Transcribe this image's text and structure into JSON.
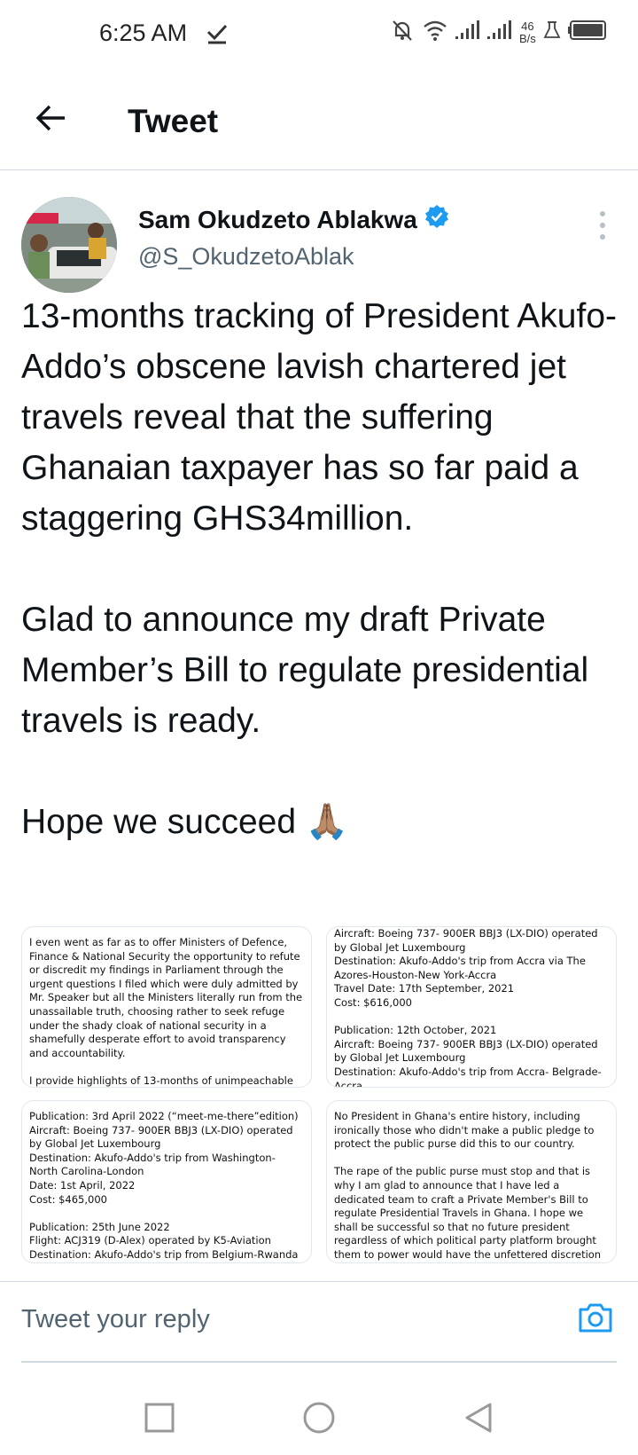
{
  "status_bar": {
    "time": "6:25 AM",
    "net_speed_value": "46",
    "net_speed_unit": "B/s",
    "icons": [
      "check-icon",
      "mute-icon",
      "wifi-icon",
      "signal-icon",
      "signal-icon",
      "lab-icon",
      "battery-icon"
    ]
  },
  "header": {
    "title": "Tweet",
    "back_icon": "arrow-left-icon"
  },
  "author": {
    "name": "Sam Okudzeto Ablakwa",
    "handle": "@S_OkudzetoAblak",
    "verified": true,
    "verified_color": "#1d9bf0"
  },
  "tweet": {
    "text": "13-months tracking of President Akufo-Addo’s obscene lavish chartered jet travels reveal that the suffering Ghanaian taxpayer has so far paid a staggering GHS34million.\n\nGlad to announce my draft Private Member’s Bill to regulate presidential travels is ready.\n\nHope we succeed 🙏🏽"
  },
  "media": [
    {
      "text": "I even went as far as to offer Ministers of Defence, Finance & National Security the opportunity to refute or discredit my findings in Parliament through the urgent questions I filed which were duly admitted by Mr. Speaker but all the Ministers literally run from the unassailable truth, choosing rather to seek refuge under the shady cloak of national security in a shamefully desperate effort to avoid transparency and accountability.\n\nI provide highlights of 13-months of unimpeachable"
    },
    {
      "text": "Aircraft: Boeing 737- 900ER BBJ3 (LX-DIO) operated by Global Jet Luxembourg\nDestination: Akufo-Addo's trip from Accra via The Azores-Houston-New York-Accra\nTravel Date: 17th September, 2021\nCost: $616,000\n\nPublication: 12th October, 2021\nAircraft: Boeing 737- 900ER BBJ3 (LX-DIO) operated by Global Jet Luxembourg\nDestination: Akufo-Addo's trip from Accra- Belgrade-Accra"
    },
    {
      "text": "Publication: 3rd April 2022 (“meet-me-there”edition)\nAircraft: Boeing 737- 900ER BBJ3 (LX-DIO) operated by Global Jet Luxembourg\nDestination: Akufo-Addo's trip from Washington- North Carolina-London\nDate: 1st April, 2022\nCost: $465,000\n\nPublication: 25th June 2022\nFlight: ACJ319 (D-Alex) operated by K5-Aviation\nDestination: Akufo-Addo's trip from Belgium-Rwanda"
    },
    {
      "text": "No President in Ghana's entire history, including ironically those who didn't make a public pledge to protect the public purse did this to our country.\n\nThe rape of the public purse must stop and that is why I am glad to announce that I have led a dedicated team to craft a Private Member's Bill to regulate Presidential Travels in Ghana. I hope we shall be successful so that no future president regardless of which political party platform brought them to power would have the unfettered discretion to subject national coffers to such"
    }
  ],
  "reply": {
    "placeholder": "Tweet your reply",
    "camera_icon": "camera-icon",
    "accent_color": "#1d9bf0"
  },
  "nav": {
    "icons": [
      "recent-apps-icon",
      "home-icon",
      "back-icon"
    ]
  }
}
